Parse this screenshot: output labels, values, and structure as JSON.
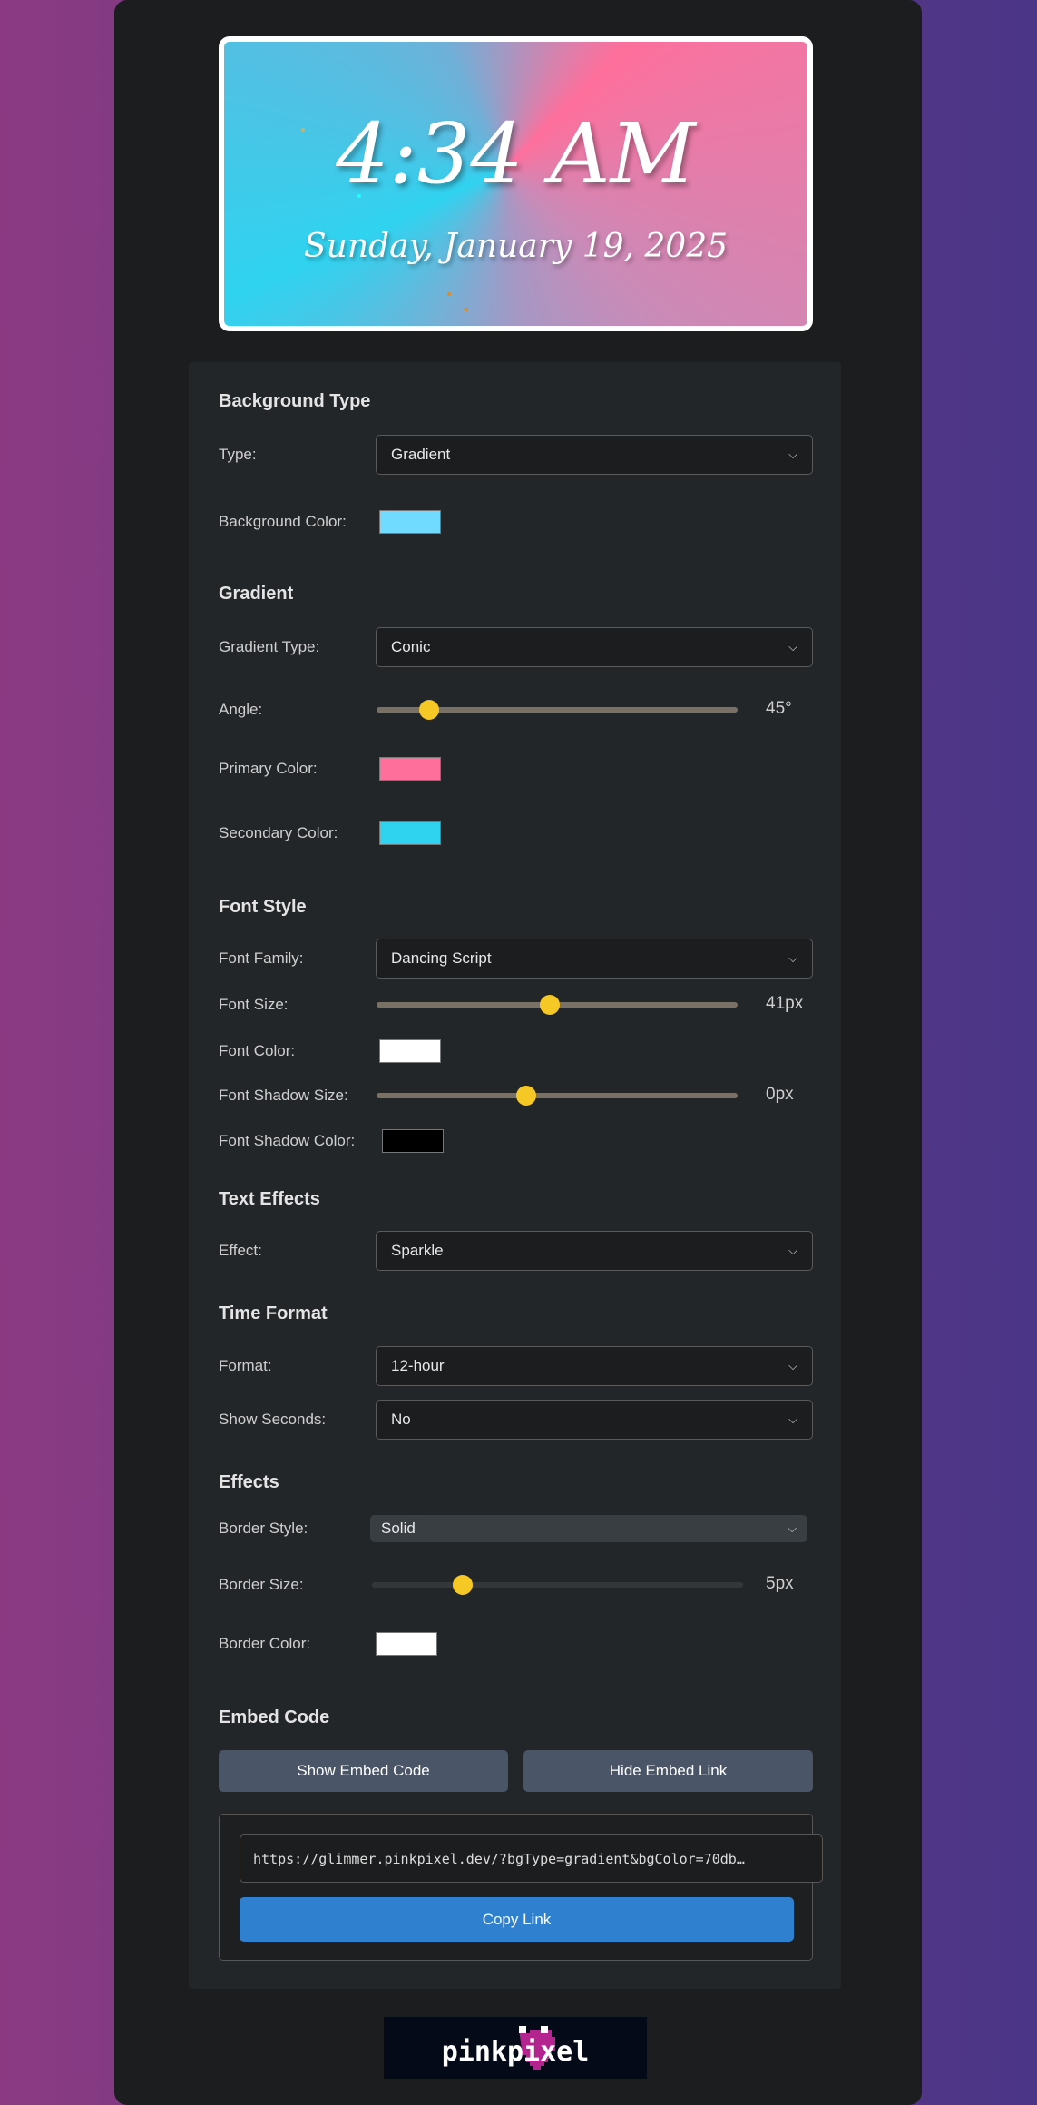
{
  "preview": {
    "time": "4:34 AM",
    "date": "Sunday, January 19, 2025"
  },
  "sections": {
    "background": {
      "title": "Background Type",
      "type_label": "Type:",
      "type_value": "Gradient",
      "color_label": "Background Color:",
      "color": "#70dbff"
    },
    "gradient": {
      "title": "Gradient",
      "type_label": "Gradient Type:",
      "type_value": "Conic",
      "angle_label": "Angle:",
      "angle_value": "45°",
      "angle": 45,
      "angle_max": 360,
      "primary_label": "Primary Color:",
      "primary_color": "#ff6f9c",
      "secondary_label": "Secondary Color:",
      "secondary_color": "#2fd3f0"
    },
    "font": {
      "title": "Font Style",
      "family_label": "Font Family:",
      "family_value": "Dancing Script",
      "size_label": "Font Size:",
      "size_value": "41px",
      "size_fraction": 0.48,
      "color_label": "Font Color:",
      "color": "#ffffff",
      "shadow_size_label": "Font Shadow Size:",
      "shadow_size_value": "0px",
      "shadow_fraction": 0.41,
      "shadow_color_label": "Font Shadow Color:",
      "shadow_color": "#000000"
    },
    "text_effects": {
      "title": "Text Effects",
      "effect_label": "Effect:",
      "effect_value": "Sparkle"
    },
    "time_format": {
      "title": "Time Format",
      "format_label": "Format:",
      "format_value": "12-hour",
      "seconds_label": "Show Seconds:",
      "seconds_value": "No"
    },
    "effects": {
      "title": "Effects",
      "border_style_label": "Border Style:",
      "border_style_value": "Solid",
      "border_size_label": "Border Size:",
      "border_size_value": "5px",
      "border_size_fraction": 0.23,
      "border_color_label": "Border Color:",
      "border_color": "#ffffff"
    },
    "embed": {
      "title": "Embed Code",
      "show_button": "Show Embed Code",
      "hide_button": "Hide Embed Link",
      "url": "https://glimmer.pinkpixel.dev/?bgType=gradient&bgColor=70db…",
      "copy_button": "Copy Link"
    }
  },
  "footer": {
    "logo_text": "pinkpixel"
  },
  "colors": {
    "accent": "#f5c825",
    "copy_button": "#2f81d0",
    "button": "#4a5567"
  },
  "icons": {
    "select": "chevron-down-icon"
  }
}
